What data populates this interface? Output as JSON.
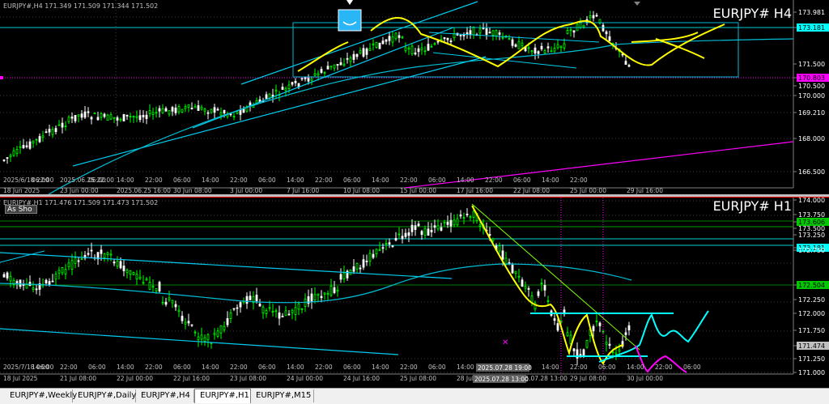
{
  "top_chart": {
    "header": "EURJPY#,H4  171.349 171.509 171.344 171.502",
    "title": "EURJPY#  H4",
    "price_labels": [
      {
        "text": "173.981",
        "style": "plain"
      },
      {
        "text": "173.181",
        "style": "cyan"
      },
      {
        "text": "171.500",
        "style": "plain"
      },
      {
        "text": "170.803",
        "style": "magenta"
      },
      {
        "text": "170.500",
        "style": "plain"
      },
      {
        "text": "170.000",
        "style": "plain"
      },
      {
        "text": "169.210",
        "style": "plain"
      },
      {
        "text": "168.000",
        "style": "plain"
      },
      {
        "text": "166.500",
        "style": "plain"
      }
    ],
    "time_labels": [
      "2025/6/18 22:00",
      "06:00",
      "2025.06.25 22:00",
      "06:00",
      "14:00",
      "22:00",
      "06:00",
      "14:00",
      "22:00",
      "06:00",
      "14:00",
      "22:00",
      "06:00",
      "14:00",
      "22:00",
      "06:00",
      "14:00",
      "22:00",
      "06:00",
      "14:00",
      "22:00"
    ],
    "date_labels": [
      "18 Jun 2025",
      "23 Jun 00:00",
      "2025.06.25 16:00",
      "30 Jun 08:00",
      "3 Jul 00:00",
      "7 Jul 16:00",
      "10 Jul 08:00",
      "15 Jul 00:00",
      "17 Jul 16:00",
      "22 Jul 08:00",
      "25 Jul 00:00",
      "29 Jul 16:00"
    ]
  },
  "bottom_chart": {
    "header": "EURJPY#,H1  171.476 171.509 171.473 171.502",
    "title": "EURJPY#  H1",
    "button_label": "As Sho",
    "price_labels": [
      {
        "text": "174.000",
        "style": "plain"
      },
      {
        "text": "173.750",
        "style": "plain"
      },
      {
        "text": "173.500",
        "style": "plain"
      },
      {
        "text": "173.606",
        "style": "green"
      },
      {
        "text": "173.250",
        "style": "plain"
      },
      {
        "text": "173.181",
        "style": "cyan"
      },
      {
        "text": "172.750",
        "style": "plain"
      },
      {
        "text": "172.504",
        "style": "green"
      },
      {
        "text": "172.250",
        "style": "plain"
      },
      {
        "text": "172.000",
        "style": "plain"
      },
      {
        "text": "171.750",
        "style": "plain"
      },
      {
        "text": "171.474",
        "style": "gray"
      },
      {
        "text": "171.250",
        "style": "plain"
      },
      {
        "text": "171.000",
        "style": "plain"
      }
    ],
    "time_labels": [
      "2025/7/18 06:00",
      "14:00",
      "22:00",
      "06:00",
      "14:00",
      "22:00",
      "06:00",
      "14:00",
      "22:00",
      "06:00",
      "14:00",
      "22:00",
      "06:00",
      "14:00",
      "22:00",
      "06:00",
      "14:00",
      "22:00",
      "06:00",
      "14:00",
      "22:00",
      "06:00",
      "14:00",
      "22:00",
      "06:00"
    ],
    "date_labels": [
      "18 Jul 2025",
      "21 Jul 08:00",
      "22 Jul 00:00",
      "22 Jul 16:00",
      "23 Jul 08:00",
      "24 Jul 00:00",
      "24 Jul 16:00",
      "25 Jul 08:00",
      "28 Jul 00:00",
      "2025.07.28 13:00",
      "29 Jul 08:00",
      "30 Jul 00:00"
    ],
    "crosshair_labels": [
      "2025.07.28 19:00",
      "2025.07.28 13:00"
    ]
  },
  "tabs": [
    "EURJPY#,Weekly",
    "EURJPY#,Daily",
    "EURJPY#,H4",
    "EURJPY#,H1",
    "EURJPY#,M15"
  ],
  "active_tab": "EURJPY#,H1",
  "colors": {
    "bull": "#00ff00",
    "bear": "#ffffff",
    "grid_cyan": "#00ffff",
    "projection_yellow": "#ffff00",
    "projection_magenta": "#ff00ff",
    "trendline_green": "#7fff00",
    "horizontal_green": "#008000",
    "label_magenta": "#ff00ff",
    "label_cyan": "#00ffff"
  }
}
